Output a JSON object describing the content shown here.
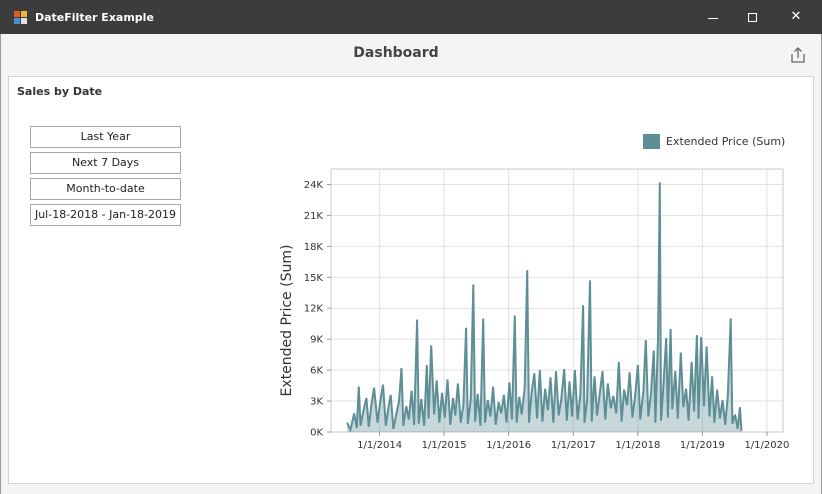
{
  "window": {
    "title": "DateFilter Example",
    "icon": "app-grid-icon",
    "controls": [
      "minimize-icon",
      "maximize-icon",
      "close-icon"
    ],
    "close_glyph": "✕"
  },
  "dashboard": {
    "title": "Dashboard",
    "export_icon": "export-icon"
  },
  "panel": {
    "title": "Sales by Date",
    "filters": [
      {
        "label": "Last Year"
      },
      {
        "label": "Next 7 Days"
      },
      {
        "label": "Month-to-date"
      },
      {
        "label": "Jul-18-2018 - Jan-18-2019"
      }
    ]
  },
  "colors": {
    "titlebar": "#3c3c3c",
    "series": "#5e8f96",
    "grid": "#e2e2e2"
  },
  "chart_data": {
    "type": "area",
    "title": "",
    "xlabel": "",
    "ylabel": "Extended Price (Sum)",
    "ylim": [
      0,
      25500
    ],
    "y_ticks": [
      0,
      3000,
      6000,
      9000,
      12000,
      15000,
      18000,
      21000,
      24000
    ],
    "y_tick_labels": [
      "0K",
      "3K",
      "6K",
      "9K",
      "12K",
      "15K",
      "18K",
      "21K",
      "24K"
    ],
    "x_ticks": [
      "2014-01-01",
      "2015-01-01",
      "2016-01-01",
      "2017-01-01",
      "2018-01-01",
      "2019-01-01",
      "2020-01-01"
    ],
    "x_tick_labels": [
      "1/1/2014",
      "1/1/2015",
      "1/1/2016",
      "1/1/2017",
      "1/1/2018",
      "1/1/2019",
      "1/1/2020"
    ],
    "xlim": [
      "2013-04-01",
      "2020-04-01"
    ],
    "grid": true,
    "legend_position": "top-right",
    "series": [
      {
        "name": "Extended Price (Sum)",
        "points": [
          [
            "2013-07-01",
            900
          ],
          [
            "2013-07-20",
            200
          ],
          [
            "2013-08-10",
            1800
          ],
          [
            "2013-08-25",
            400
          ],
          [
            "2013-09-05",
            4400
          ],
          [
            "2013-09-15",
            600
          ],
          [
            "2013-10-01",
            2000
          ],
          [
            "2013-10-18",
            3300
          ],
          [
            "2013-11-01",
            500
          ],
          [
            "2013-11-15",
            2600
          ],
          [
            "2013-12-01",
            4300
          ],
          [
            "2013-12-20",
            900
          ],
          [
            "2014-01-05",
            3000
          ],
          [
            "2014-01-20",
            4600
          ],
          [
            "2014-02-05",
            600
          ],
          [
            "2014-02-20",
            2400
          ],
          [
            "2014-03-05",
            3600
          ],
          [
            "2014-03-20",
            300
          ],
          [
            "2014-04-05",
            1700
          ],
          [
            "2014-04-20",
            2900
          ],
          [
            "2014-05-05",
            6200
          ],
          [
            "2014-05-15",
            600
          ],
          [
            "2014-06-01",
            2500
          ],
          [
            "2014-06-15",
            1200
          ],
          [
            "2014-07-01",
            4000
          ],
          [
            "2014-07-15",
            700
          ],
          [
            "2014-08-01",
            10900
          ],
          [
            "2014-08-10",
            800
          ],
          [
            "2014-08-25",
            3200
          ],
          [
            "2014-09-10",
            600
          ],
          [
            "2014-09-25",
            6500
          ],
          [
            "2014-10-05",
            1300
          ],
          [
            "2014-10-20",
            8400
          ],
          [
            "2014-11-05",
            1700
          ],
          [
            "2014-11-20",
            5000
          ],
          [
            "2014-12-05",
            900
          ],
          [
            "2014-12-20",
            3800
          ],
          [
            "2015-01-05",
            1400
          ],
          [
            "2015-01-20",
            5100
          ],
          [
            "2015-02-05",
            700
          ],
          [
            "2015-02-20",
            3300
          ],
          [
            "2015-03-05",
            1600
          ],
          [
            "2015-03-20",
            4700
          ],
          [
            "2015-04-05",
            900
          ],
          [
            "2015-04-20",
            2600
          ],
          [
            "2015-05-05",
            10100
          ],
          [
            "2015-05-15",
            800
          ],
          [
            "2015-06-01",
            3200
          ],
          [
            "2015-06-15",
            14300
          ],
          [
            "2015-06-25",
            1000
          ],
          [
            "2015-07-10",
            3700
          ],
          [
            "2015-07-25",
            600
          ],
          [
            "2015-08-10",
            11000
          ],
          [
            "2015-08-20",
            900
          ],
          [
            "2015-09-05",
            3100
          ],
          [
            "2015-09-20",
            1500
          ],
          [
            "2015-10-05",
            4400
          ],
          [
            "2015-10-20",
            700
          ],
          [
            "2015-11-05",
            2900
          ],
          [
            "2015-11-20",
            1800
          ],
          [
            "2015-12-05",
            3600
          ],
          [
            "2015-12-20",
            900
          ],
          [
            "2016-01-05",
            4800
          ],
          [
            "2016-01-20",
            1200
          ],
          [
            "2016-02-05",
            11300
          ],
          [
            "2016-02-15",
            900
          ],
          [
            "2016-03-01",
            3400
          ],
          [
            "2016-03-15",
            1700
          ],
          [
            "2016-04-01",
            4300
          ],
          [
            "2016-04-15",
            15700
          ],
          [
            "2016-04-25",
            900
          ],
          [
            "2016-05-10",
            3800
          ],
          [
            "2016-05-25",
            5700
          ],
          [
            "2016-06-10",
            1300
          ],
          [
            "2016-06-25",
            6000
          ],
          [
            "2016-07-10",
            1000
          ],
          [
            "2016-07-25",
            4200
          ],
          [
            "2016-08-10",
            2100
          ],
          [
            "2016-08-25",
            5300
          ],
          [
            "2016-09-10",
            900
          ],
          [
            "2016-09-25",
            5900
          ],
          [
            "2016-10-10",
            1600
          ],
          [
            "2016-10-25",
            3200
          ],
          [
            "2016-11-10",
            6100
          ],
          [
            "2016-11-25",
            1100
          ],
          [
            "2016-12-10",
            4900
          ],
          [
            "2016-12-25",
            1500
          ],
          [
            "2017-01-10",
            6000
          ],
          [
            "2017-01-25",
            1200
          ],
          [
            "2017-02-10",
            3700
          ],
          [
            "2017-02-25",
            12300
          ],
          [
            "2017-03-05",
            900
          ],
          [
            "2017-03-20",
            3100
          ],
          [
            "2017-04-05",
            14700
          ],
          [
            "2017-04-15",
            1000
          ],
          [
            "2017-05-01",
            5400
          ],
          [
            "2017-05-15",
            1600
          ],
          [
            "2017-06-01",
            3900
          ],
          [
            "2017-06-15",
            5900
          ],
          [
            "2017-07-01",
            1200
          ],
          [
            "2017-07-15",
            4700
          ],
          [
            "2017-08-01",
            2300
          ],
          [
            "2017-08-15",
            3500
          ],
          [
            "2017-09-01",
            1800
          ],
          [
            "2017-09-15",
            6800
          ],
          [
            "2017-10-01",
            1000
          ],
          [
            "2017-10-15",
            4100
          ],
          [
            "2017-11-01",
            2600
          ],
          [
            "2017-11-15",
            5800
          ],
          [
            "2017-12-01",
            1400
          ],
          [
            "2017-12-15",
            3300
          ],
          [
            "2018-01-01",
            6500
          ],
          [
            "2018-01-15",
            1200
          ],
          [
            "2018-02-01",
            4000
          ],
          [
            "2018-02-15",
            8900
          ],
          [
            "2018-03-01",
            1500
          ],
          [
            "2018-03-15",
            3500
          ],
          [
            "2018-04-01",
            7900
          ],
          [
            "2018-04-10",
            900
          ],
          [
            "2018-04-25",
            9000
          ],
          [
            "2018-05-05",
            24200
          ],
          [
            "2018-05-12",
            1100
          ],
          [
            "2018-05-25",
            4300
          ],
          [
            "2018-06-10",
            9100
          ],
          [
            "2018-06-20",
            1400
          ],
          [
            "2018-07-05",
            10000
          ],
          [
            "2018-07-15",
            2200
          ],
          [
            "2018-08-01",
            5900
          ],
          [
            "2018-08-15",
            1300
          ],
          [
            "2018-09-01",
            7700
          ],
          [
            "2018-09-15",
            2400
          ],
          [
            "2018-10-01",
            4200
          ],
          [
            "2018-10-15",
            1100
          ],
          [
            "2018-11-01",
            6800
          ],
          [
            "2018-11-15",
            2000
          ],
          [
            "2018-12-01",
            9400
          ],
          [
            "2018-12-10",
            1300
          ],
          [
            "2018-12-25",
            9200
          ],
          [
            "2019-01-10",
            2500
          ],
          [
            "2019-01-25",
            8300
          ],
          [
            "2019-02-10",
            1500
          ],
          [
            "2019-02-25",
            5400
          ],
          [
            "2019-03-10",
            900
          ],
          [
            "2019-03-25",
            4100
          ],
          [
            "2019-04-10",
            1300
          ],
          [
            "2019-04-25",
            3100
          ],
          [
            "2019-05-10",
            700
          ],
          [
            "2019-05-25",
            3500
          ],
          [
            "2019-06-10",
            11000
          ],
          [
            "2019-06-20",
            800
          ],
          [
            "2019-07-05",
            1700
          ],
          [
            "2019-07-20",
            300
          ],
          [
            "2019-08-01",
            2400
          ],
          [
            "2019-08-10",
            100
          ]
        ]
      }
    ]
  }
}
